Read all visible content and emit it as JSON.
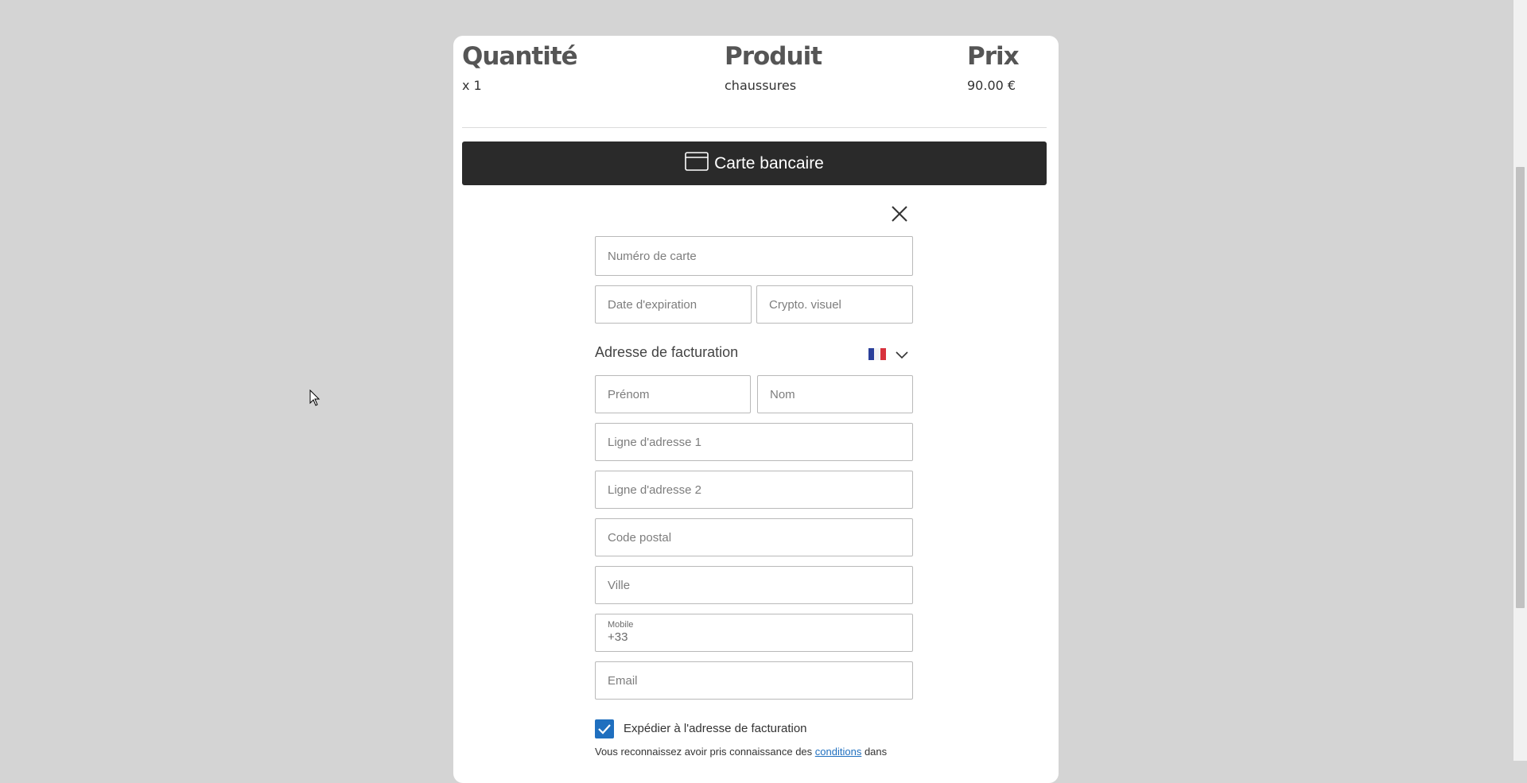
{
  "order_summary": {
    "headers": {
      "quantity": "Quantité",
      "product": "Produit",
      "price": "Prix"
    },
    "row": {
      "quantity": "x 1",
      "product": "chaussures",
      "price": "90.00 €"
    }
  },
  "payment_method": {
    "icon": "credit-card-icon",
    "label": "Carte bancaire"
  },
  "card_form": {
    "card_number_placeholder": "Numéro de carte",
    "expiry_placeholder": "Date d'expiration",
    "cvv_placeholder": "Crypto. visuel"
  },
  "billing": {
    "title": "Adresse de facturation",
    "country_flag": "france-flag-icon",
    "first_name_placeholder": "Prénom",
    "last_name_placeholder": "Nom",
    "address1_placeholder": "Ligne d'adresse 1",
    "address2_placeholder": "Ligne d'adresse 2",
    "postal_code_placeholder": "Code postal",
    "city_placeholder": "Ville",
    "mobile_label": "Mobile",
    "mobile_value": "+33",
    "email_placeholder": "Email"
  },
  "ship_to_billing": {
    "checked": true,
    "label": "Expédier à l'adresse de facturation"
  },
  "terms": {
    "before": "Vous reconnaissez avoir pris connaissance des",
    "link": "conditions",
    "after": "dans"
  },
  "colors": {
    "page_bg": "#d4d4d4",
    "method_bar": "#2a2a2a",
    "accent": "#1f6fbf"
  }
}
